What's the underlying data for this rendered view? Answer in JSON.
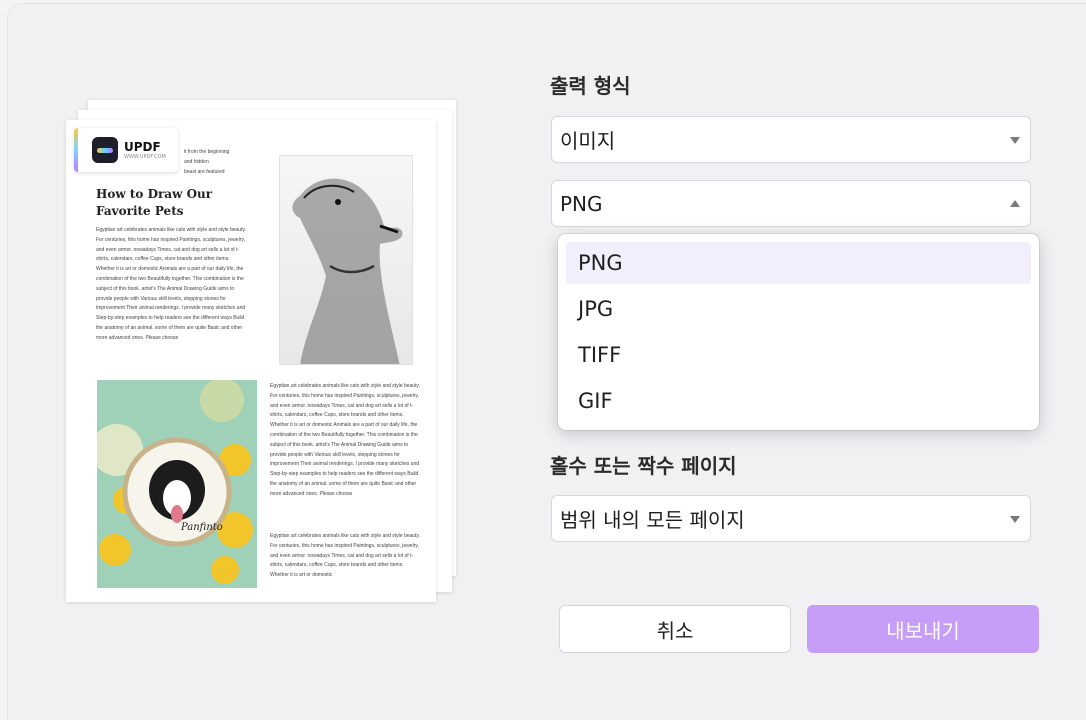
{
  "preview": {
    "logo_name": "UPDF",
    "logo_sub": "WWW.UPDF.COM",
    "doc_title": "How to Draw Our Favorite Pets",
    "snippet_top": "it from the beginning\nand hidden\nbeast are featured",
    "body_1": "Egyptian art celebrates animals like cats with style and style beauty. For centuries, this home has inspired Paintings, sculptures, jewelry, and even armor. nowadays Times, cat and dog art sells a lot of t-shirts, calendars, coffee Cups, store brands and other items. Whether it is art or domestic Animals are a part of our daily life, the combination of the two Beautifully together. This combination is the subject of this book. artist's The Animal Drawing Guide aims to provide people with Various skill levels, stepping stones for improvement Their animal renderings. I provide many sketches and Step-by-step examples to help readers see the different ways Build the anatomy of an animal. some of them are quite Basic and other more advanced ones. Please choose",
    "body_2": "Egyptian art celebrates animals like cats with style and style beauty. For centuries, this home has inspired Paintings, sculptures, jewelry, and even armor. nowadays Times, cat and dog art sells a lot of t-shirts, calendars, coffee Cups, store brands and other items. Whether it is art or domestic Animals are a part of our daily life, the combination of the two Beautifully together. This combination is the subject of this book. artist's The Animal Drawing Guide aims to provide people with Various skill levels, stepping stones for improvement Their animal renderings. I provide many sketches and Step-by-step examples to help readers see the different ways Build the anatomy of an animal. some of them are quite Basic and other more advanced ones. Please choose",
    "body_3": "Egyptian art celebrates animals like cats with style and style beauty. For centuries, this home has inspired Paintings, sculptures, jewelry, and even armor. nowadays Times, cat and dog art sells a lot of t-shirts, calendars, coffee Cups, store brands and other items. Whether it is art or domestic",
    "embroidery_text": "Panfinto"
  },
  "settings": {
    "output_format_label": "출력 형식",
    "output_format_value": "이미지",
    "image_type_value": "PNG",
    "image_type_options": [
      "PNG",
      "JPG",
      "TIFF",
      "GIF"
    ],
    "odd_even_label": "홀수 또는 짝수 페이지",
    "odd_even_value": "범위 내의 모든 페이지"
  },
  "buttons": {
    "cancel": "취소",
    "export": "내보내기"
  },
  "colors": {
    "accent": "#c69df7",
    "selected_item": "#f3eefb"
  }
}
